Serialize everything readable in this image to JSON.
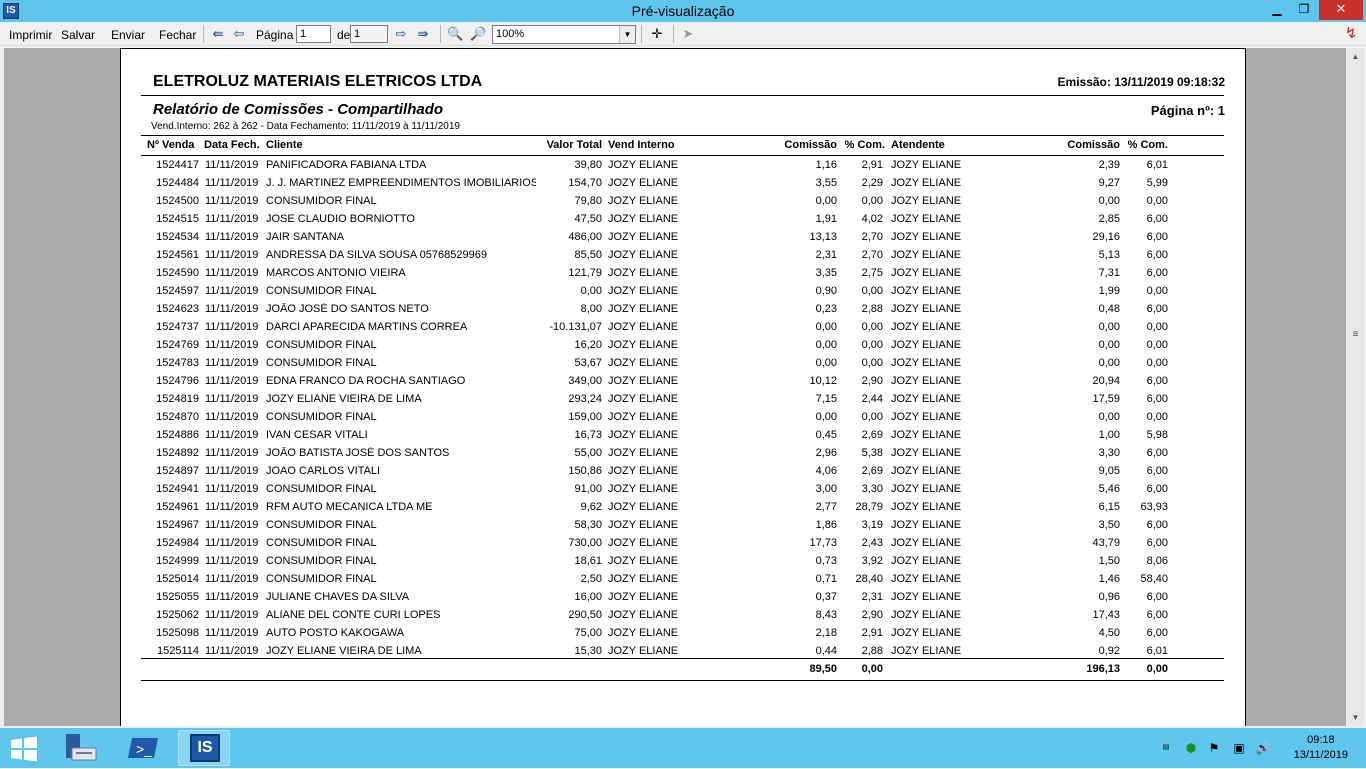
{
  "window": {
    "title": "Pré-visualização",
    "app_icon_label": "IS",
    "minimize_glyph": "▁",
    "maximize_glyph": "❐",
    "close_glyph": "✕"
  },
  "toolbar": {
    "print_label": "Imprimir",
    "save_label": "Salvar",
    "send_label": "Enviar",
    "close_label": "Fechar",
    "page_label": "Página",
    "page_value": "1",
    "of_label": "de",
    "total_pages": "1",
    "zoom_value": "100%"
  },
  "report": {
    "company": "ELETROLUZ MATERIAIS ELETRICOS LTDA",
    "emission": "Emissão: 13/11/2019 09:18:32",
    "title": "Relatório de Comissões - Compartilhado",
    "page_number": "Página nº: 1",
    "filter": "Vend.Interno: 262 à 262  -  Data Fechamento: 11/11/2019 à 11/11/2019",
    "columns": {
      "num_venda": "Nº Venda",
      "data_fech": "Data Fech.",
      "cliente": "Cliente",
      "valor_total": "Valor Total",
      "vend_interno": "Vend Interno",
      "comissao1": "Comissão",
      "pct1": "% Com.",
      "atendente": "Atendente",
      "comissao2": "Comissão",
      "pct2": "% Com."
    },
    "rows": [
      [
        "1524417",
        "11/11/2019",
        "PANIFICADORA FABIANA LTDA",
        "39,80",
        "JOZY ELIANE",
        "1,16",
        "2,91",
        "JOZY ELIANE",
        "2,39",
        "6,01"
      ],
      [
        "1524484",
        "11/11/2019",
        "J. J. MARTINEZ EMPREENDIMENTOS IMOBILIARIOS LTDA",
        "154,70",
        "JOZY ELIANE",
        "3,55",
        "2,29",
        "JOZY ELIANE",
        "9,27",
        "5,99"
      ],
      [
        "1524500",
        "11/11/2019",
        "CONSUMIDOR FINAL",
        "79,80",
        "JOZY ELIANE",
        "0,00",
        "0,00",
        "JOZY ELIANE",
        "0,00",
        "0,00"
      ],
      [
        "1524515",
        "11/11/2019",
        "JOSE CLAUDIO BORNIOTTO",
        "47,50",
        "JOZY ELIANE",
        "1,91",
        "4,02",
        "JOZY ELIANE",
        "2,85",
        "6,00"
      ],
      [
        "1524534",
        "11/11/2019",
        "JAIR SANTANA",
        "486,00",
        "JOZY ELIANE",
        "13,13",
        "2,70",
        "JOZY ELIANE",
        "29,16",
        "6,00"
      ],
      [
        "1524561",
        "11/11/2019",
        "ANDRESSA DA SILVA SOUSA 05768529969",
        "85,50",
        "JOZY ELIANE",
        "2,31",
        "2,70",
        "JOZY ELIANE",
        "5,13",
        "6,00"
      ],
      [
        "1524590",
        "11/11/2019",
        "MARCOS ANTONIO VIEIRA",
        "121,79",
        "JOZY ELIANE",
        "3,35",
        "2,75",
        "JOZY ELIANE",
        "7,31",
        "6,00"
      ],
      [
        "1524597",
        "11/11/2019",
        "CONSUMIDOR FINAL",
        "0,00",
        "JOZY ELIANE",
        "0,90",
        "0,00",
        "JOZY ELIANE",
        "1,99",
        "0,00"
      ],
      [
        "1524623",
        "11/11/2019",
        "JOÃO JOSÉ DO SANTOS NETO",
        "8,00",
        "JOZY ELIANE",
        "0,23",
        "2,88",
        "JOZY ELIANE",
        "0,48",
        "6,00"
      ],
      [
        "1524737",
        "11/11/2019",
        "DARCI APARECIDA MARTINS CORREA",
        "-10.131,07",
        "JOZY ELIANE",
        "0,00",
        "0,00",
        "JOZY ELIANE",
        "0,00",
        "0,00"
      ],
      [
        "1524769",
        "11/11/2019",
        "CONSUMIDOR FINAL",
        "16,20",
        "JOZY ELIANE",
        "0,00",
        "0,00",
        "JOZY ELIANE",
        "0,00",
        "0,00"
      ],
      [
        "1524783",
        "11/11/2019",
        "CONSUMIDOR FINAL",
        "53,67",
        "JOZY ELIANE",
        "0,00",
        "0,00",
        "JOZY ELIANE",
        "0,00",
        "0,00"
      ],
      [
        "1524796",
        "11/11/2019",
        "EDNA FRANCO DA ROCHA SANTIAGO",
        "349,00",
        "JOZY ELIANE",
        "10,12",
        "2,90",
        "JOZY ELIANE",
        "20,94",
        "6,00"
      ],
      [
        "1524819",
        "11/11/2019",
        "JOZY ELIANE VIEIRA DE LIMA",
        "293,24",
        "JOZY ELIANE",
        "7,15",
        "2,44",
        "JOZY ELIANE",
        "17,59",
        "6,00"
      ],
      [
        "1524870",
        "11/11/2019",
        "CONSUMIDOR FINAL",
        "159,00",
        "JOZY ELIANE",
        "0,00",
        "0,00",
        "JOZY ELIANE",
        "0,00",
        "0,00"
      ],
      [
        "1524886",
        "11/11/2019",
        "IVAN CESAR VITALI",
        "16,73",
        "JOZY ELIANE",
        "0,45",
        "2,69",
        "JOZY ELIANE",
        "1,00",
        "5,98"
      ],
      [
        "1524892",
        "11/11/2019",
        "JOÃO BATISTA JOSÉ DOS SANTOS",
        "55,00",
        "JOZY ELIANE",
        "2,96",
        "5,38",
        "JOZY ELIANE",
        "3,30",
        "6,00"
      ],
      [
        "1524897",
        "11/11/2019",
        "JOAO CARLOS VITALI",
        "150,86",
        "JOZY ELIANE",
        "4,06",
        "2,69",
        "JOZY ELIANE",
        "9,05",
        "6,00"
      ],
      [
        "1524941",
        "11/11/2019",
        "CONSUMIDOR FINAL",
        "91,00",
        "JOZY ELIANE",
        "3,00",
        "3,30",
        "JOZY ELIANE",
        "5,46",
        "6,00"
      ],
      [
        "1524961",
        "11/11/2019",
        "RFM AUTO MECANICA LTDA ME",
        "9,62",
        "JOZY ELIANE",
        "2,77",
        "28,79",
        "JOZY ELIANE",
        "6,15",
        "63,93"
      ],
      [
        "1524967",
        "11/11/2019",
        "CONSUMIDOR FINAL",
        "58,30",
        "JOZY ELIANE",
        "1,86",
        "3,19",
        "JOZY ELIANE",
        "3,50",
        "6,00"
      ],
      [
        "1524984",
        "11/11/2019",
        "CONSUMIDOR FINAL",
        "730,00",
        "JOZY ELIANE",
        "17,73",
        "2,43",
        "JOZY ELIANE",
        "43,79",
        "6,00"
      ],
      [
        "1524999",
        "11/11/2019",
        "CONSUMIDOR FINAL",
        "18,61",
        "JOZY ELIANE",
        "0,73",
        "3,92",
        "JOZY ELIANE",
        "1,50",
        "8,06"
      ],
      [
        "1525014",
        "11/11/2019",
        "CONSUMIDOR FINAL",
        "2,50",
        "JOZY ELIANE",
        "0,71",
        "28,40",
        "JOZY ELIANE",
        "1,46",
        "58,40"
      ],
      [
        "1525055",
        "11/11/2019",
        "JULIANE CHAVES DA SILVA",
        "16,00",
        "JOZY ELIANE",
        "0,37",
        "2,31",
        "JOZY ELIANE",
        "0,96",
        "6,00"
      ],
      [
        "1525062",
        "11/11/2019",
        "ALIANE DEL CONTE CURI LOPES",
        "290,50",
        "JOZY ELIANE",
        "8,43",
        "2,90",
        "JOZY ELIANE",
        "17,43",
        "6,00"
      ],
      [
        "1525098",
        "11/11/2019",
        "AUTO POSTO KAKOGAWA",
        "75,00",
        "JOZY ELIANE",
        "2,18",
        "2,91",
        "JOZY ELIANE",
        "4,50",
        "6,00"
      ],
      [
        "1525114",
        "11/11/2019",
        "JOZY ELIANE VIEIRA DE LIMA",
        "15,30",
        "JOZY ELIANE",
        "0,44",
        "2,88",
        "JOZY ELIANE",
        "0,92",
        "6,01"
      ]
    ],
    "totals": {
      "comissao1": "89,50",
      "pct1": "0,00",
      "comissao2": "196,13",
      "pct2": "0,00"
    }
  },
  "taskbar": {
    "clock_time": "09:18",
    "clock_date": "13/11/2019",
    "active_app_label": "IS"
  }
}
